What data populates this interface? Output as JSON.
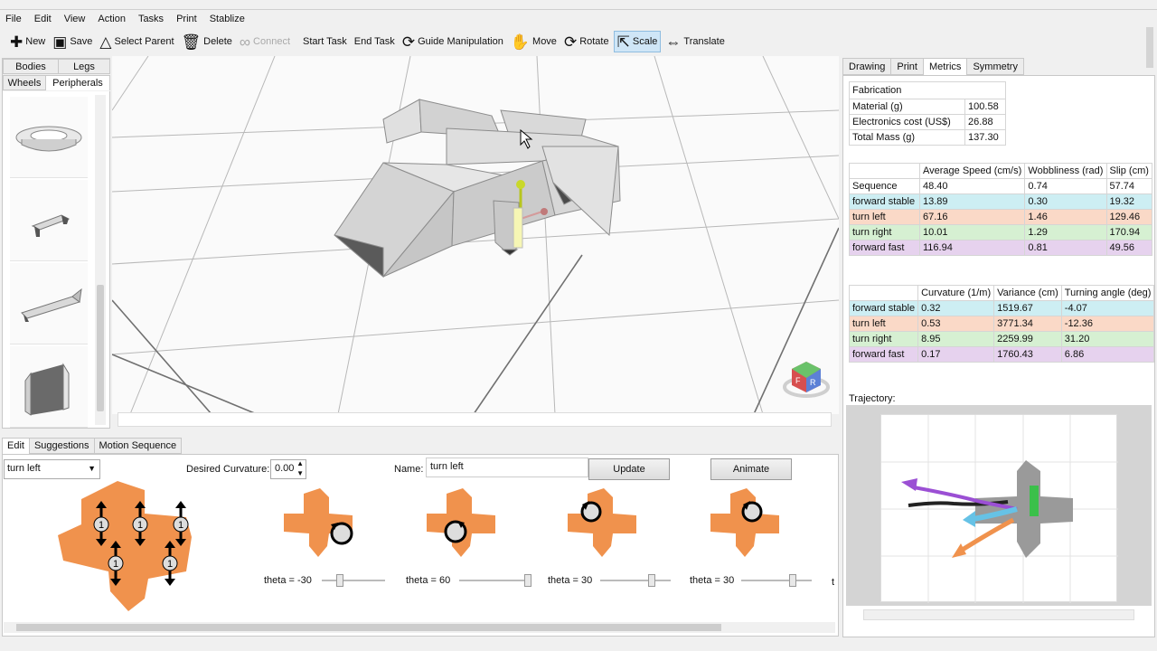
{
  "menu": [
    "File",
    "Edit",
    "View",
    "Action",
    "Tasks",
    "Print",
    "Stablize"
  ],
  "toolbar": {
    "new": "New",
    "save": "Save",
    "select_parent": "Select Parent",
    "delete": "Delete",
    "connect": "Connect",
    "start_task": "Start Task",
    "end_task": "End Task",
    "guide": "Guide Manipulation",
    "move": "Move",
    "rotate": "Rotate",
    "scale": "Scale",
    "translate": "Translate"
  },
  "left_tabs": {
    "bodies": "Bodies",
    "legs": "Legs",
    "wheels": "Wheels",
    "peripherals": "Peripherals"
  },
  "bottom_tabs": {
    "edit": "Edit",
    "suggestions": "Suggestions",
    "motion": "Motion Sequence"
  },
  "edit": {
    "motion_select": "turn left",
    "desired_curvature_label": "Desired Curvature:",
    "desired_curvature_value": "0.00",
    "name_label": "Name:",
    "name_value": "turn left",
    "update": "Update",
    "animate": "Animate",
    "leg_badge": "1",
    "thetas": [
      {
        "label": "theta =",
        "value": "-30",
        "slider": 0.25
      },
      {
        "label": "theta =",
        "value": "60",
        "slider": 1.0
      },
      {
        "label": "theta =",
        "value": "30",
        "slider": 0.75
      },
      {
        "label": "theta =",
        "value": "30",
        "slider": 0.75
      }
    ],
    "theta_cut": "t"
  },
  "right_tabs": {
    "drawing": "Drawing",
    "print": "Print",
    "metrics": "Metrics",
    "symmetry": "Symmetry"
  },
  "metrics": {
    "fabrication": {
      "header": "Fabrication",
      "rows": [
        {
          "label": "Material (g)",
          "value": "100.58"
        },
        {
          "label": "Electronics cost (US$)",
          "value": "26.88"
        },
        {
          "label": "Total Mass (g)",
          "value": "137.30"
        }
      ]
    },
    "gait": {
      "headers": [
        "",
        "Average Speed (cm/s)",
        "Wobbliness (rad)",
        "Slip (cm)"
      ],
      "rows": [
        {
          "name": "Sequence",
          "speed": "48.40",
          "wobble": "0.74",
          "slip": "57.74",
          "color": ""
        },
        {
          "name": "forward stable",
          "speed": "13.89",
          "wobble": "0.30",
          "slip": "19.32",
          "color": "c-fs"
        },
        {
          "name": "turn left",
          "speed": "67.16",
          "wobble": "1.46",
          "slip": "129.46",
          "color": "c-tl"
        },
        {
          "name": "turn right",
          "speed": "10.01",
          "wobble": "1.29",
          "slip": "170.94",
          "color": "c-tr"
        },
        {
          "name": "forward fast",
          "speed": "116.94",
          "wobble": "0.81",
          "slip": "49.56",
          "color": "c-ff"
        }
      ]
    },
    "curvature": {
      "headers": [
        "",
        "Curvature (1/m)",
        "Variance (cm)",
        "Turning angle (deg)"
      ],
      "rows": [
        {
          "name": "forward stable",
          "curv": "0.32",
          "var": "1519.67",
          "angle": "-4.07",
          "color": "c-fs"
        },
        {
          "name": "turn left",
          "curv": "0.53",
          "var": "3771.34",
          "angle": "-12.36",
          "color": "c-tl"
        },
        {
          "name": "turn right",
          "curv": "8.95",
          "var": "2259.99",
          "angle": "31.20",
          "color": "c-tr"
        },
        {
          "name": "forward fast",
          "curv": "0.17",
          "var": "1760.43",
          "angle": "6.86",
          "color": "c-ff"
        }
      ]
    },
    "trajectory_label": "Trajectory:"
  },
  "colors": {
    "orange": "#f0924d",
    "accent": "#cfe6f7",
    "grid": "#9a9a9a",
    "robot": "#d9d9d9"
  }
}
